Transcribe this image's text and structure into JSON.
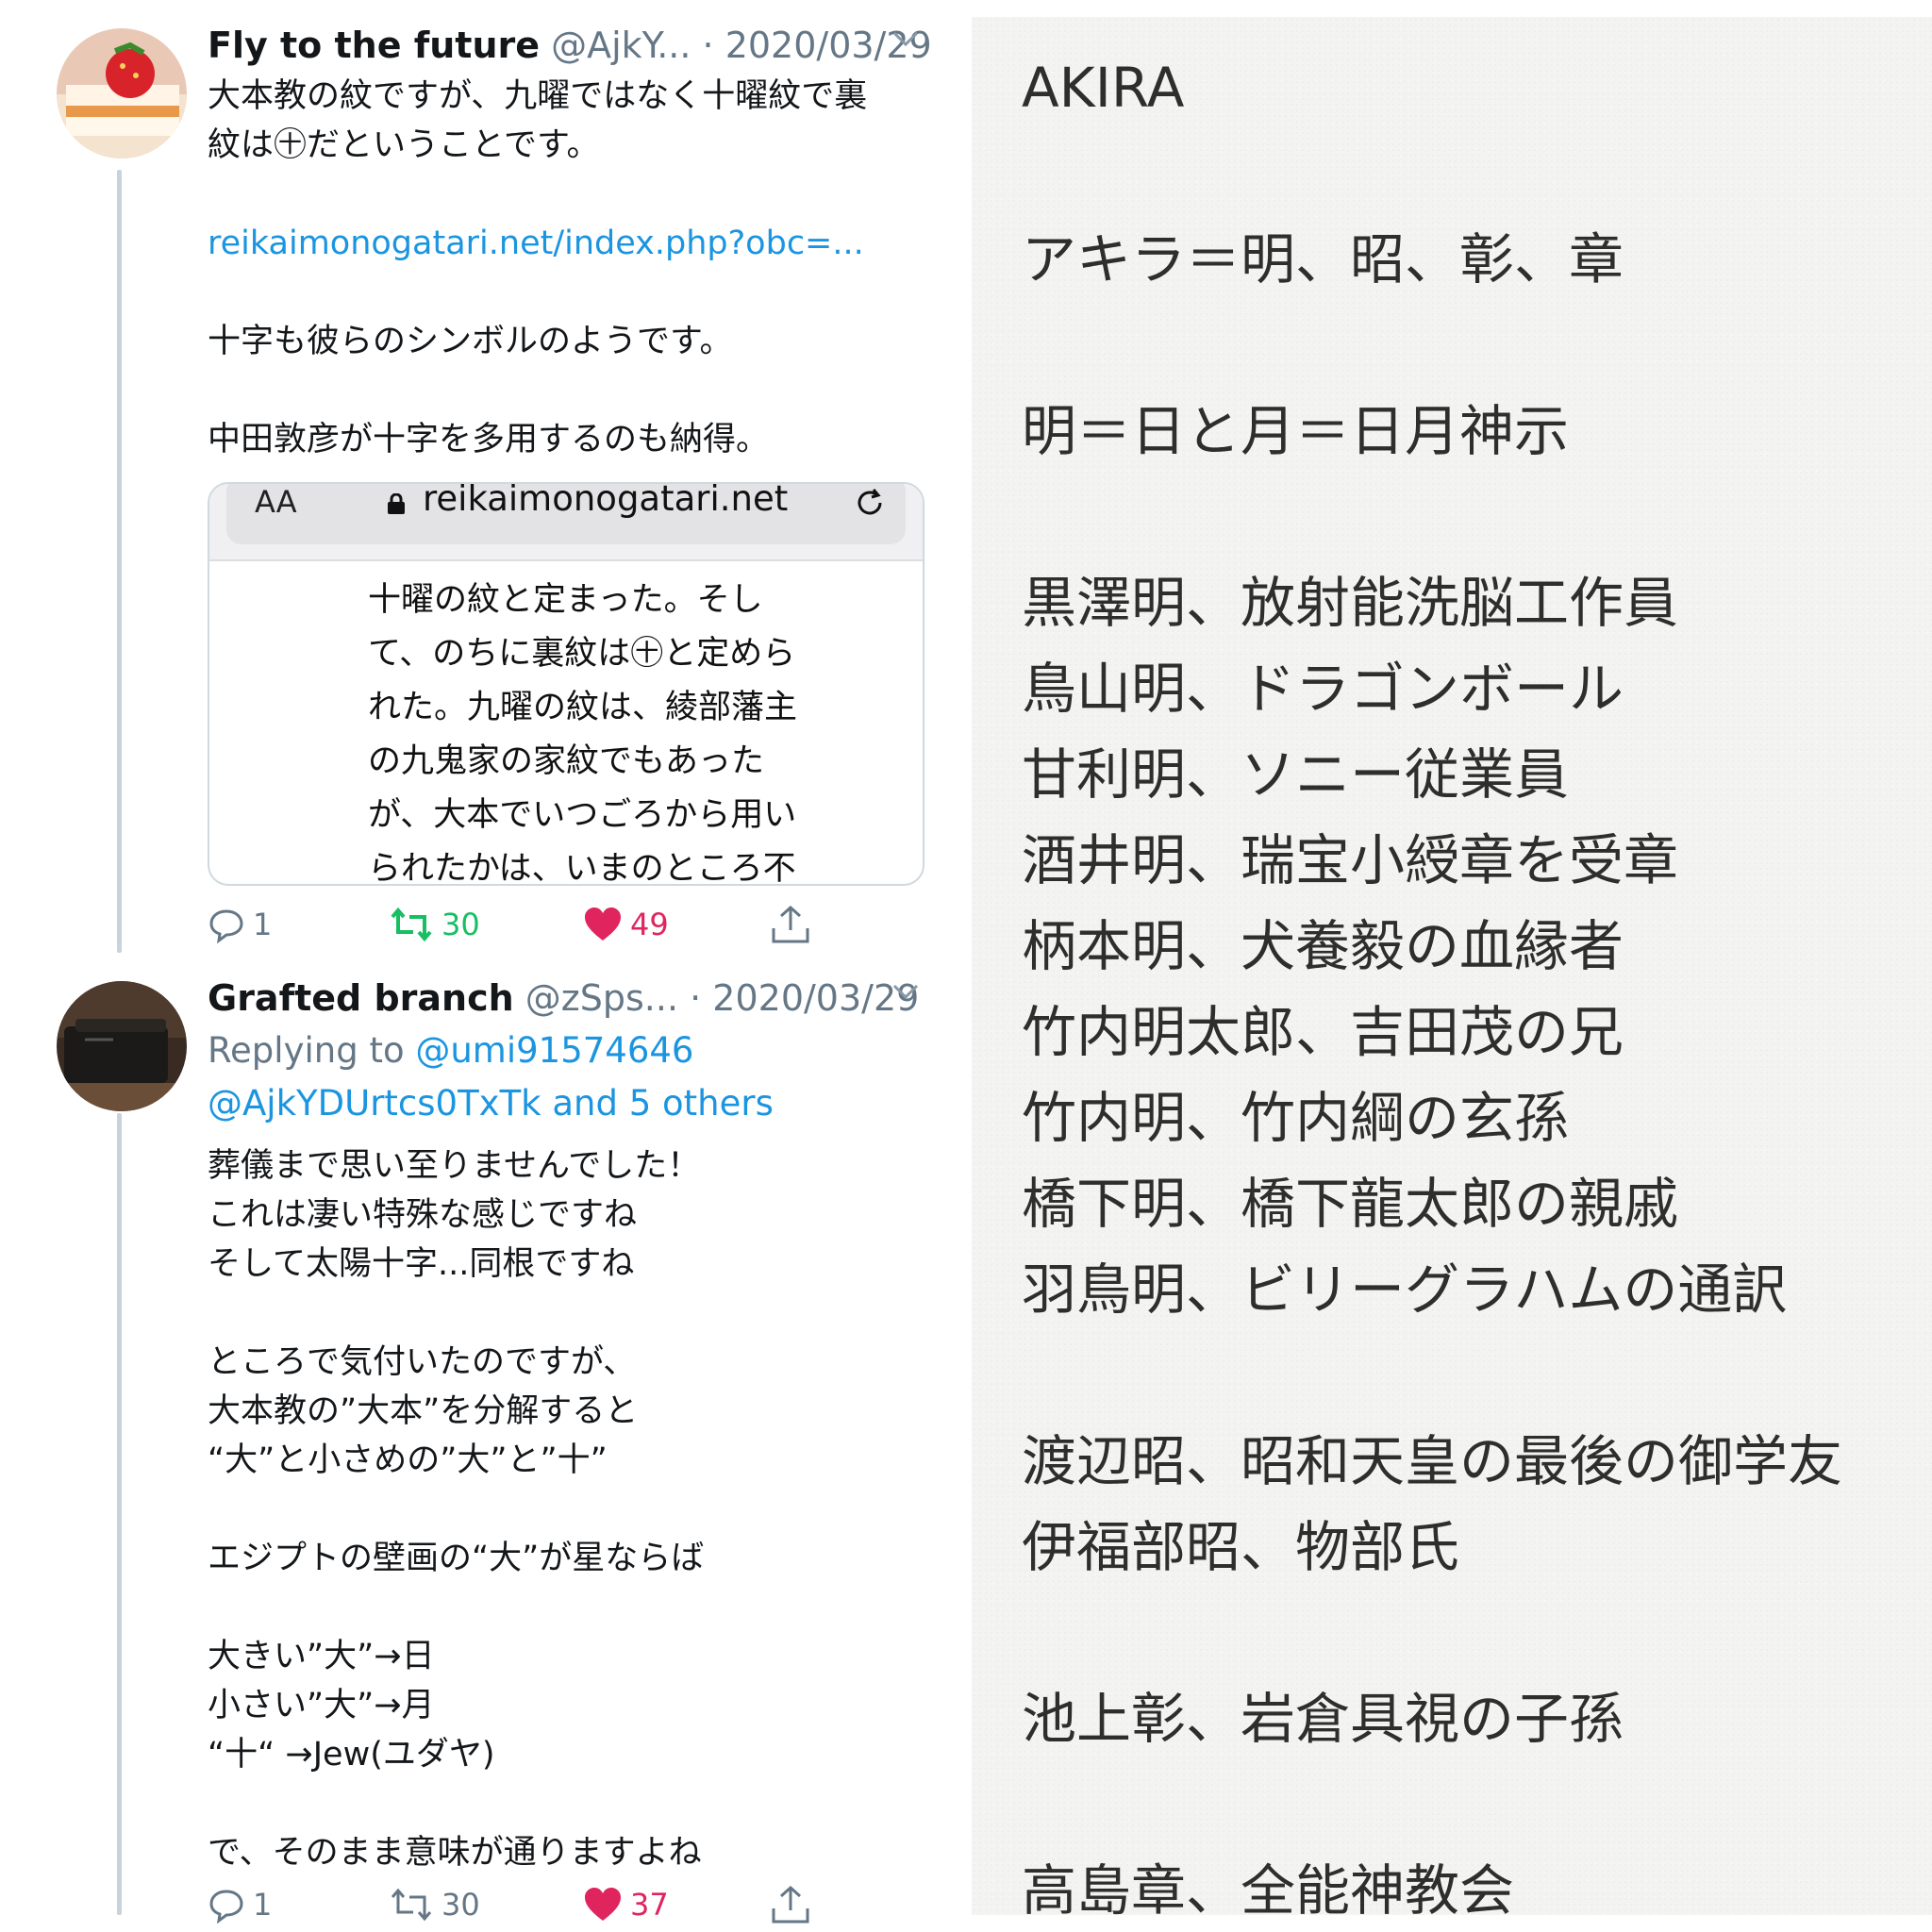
{
  "tweet1": {
    "name": "Fly to the future",
    "handle": "@AjkY...",
    "date": "· 2020/03/29",
    "lines": [
      "大本教の紋ですが、九曜ではなく十曜紋で裏",
      "紋は㊉だということです。",
      "",
      "reikaimonogatari.net/index.php?obc=...",
      "",
      "十字も彼らのシンボルのようです。",
      "",
      "中田敦彦が十字を多用するのも納得。"
    ],
    "card": {
      "aa_label": "AA",
      "domain": "reikaimonogatari.net",
      "body_lines": [
        "十曜の紋と定まった。そし",
        "て、のちに裏紋は㊉と定めら",
        "れた。九曜の紋は、綾部藩主",
        "の九鬼家の家紋でもあった",
        "が、大本でいつごろから用い",
        "られたかは、いまのところ不"
      ]
    },
    "replies": "1",
    "retweets": "30",
    "likes": "49"
  },
  "tweet2": {
    "name": "Grafted branch",
    "handle": "@zSps...",
    "date": "· 2020/03/29",
    "replying_prefix": "Replying to ",
    "replying_to": "@umi91574646",
    "replying_to_line2": "@AjkYDUrtcs0TxTk and 5 others",
    "lines": [
      "葬儀まで思い至りませんでした！",
      "これは凄い特殊な感じですね",
      "そして太陽十字...同根ですね",
      "",
      "ところで気付いたのですが、",
      "大本教の”大本”を分解すると",
      "“大”と小さめの”大”と”十”",
      "",
      "エジプトの壁画の“大”が星ならば",
      "",
      "大きい”大”→日",
      "小さい”大”→月",
      "“十“ →Jew(ユダヤ)",
      "",
      "で、そのまま意味が通りますよね"
    ],
    "replies": "1",
    "retweets": "30",
    "likes": "37"
  },
  "note": {
    "lines": [
      "AKIRA",
      "アキラ＝明、昭、彰、章",
      "明＝日と月＝日月神示",
      "黒澤明、放射能洗脳工作員",
      "鳥山明、ドラゴンボール",
      "甘利明、ソニー従業員",
      "酒井明、瑞宝小綬章を受章",
      "柄本明、犬養毅の血縁者",
      "竹内明太郎、吉田茂の兄",
      "竹内明、竹内綱の玄孫",
      "橋下明、橋下龍太郎の親戚",
      "羽鳥明、ビリーグラハムの通訳",
      "渡辺昭、昭和天皇の最後の御学友",
      "伊福部昭、物部氏",
      "池上彰、岩倉具視の子孫",
      "高島章、全能神教会"
    ]
  },
  "colors": {
    "link": "#1b95e0",
    "retweet": "#17bf63",
    "like": "#e0245e",
    "muted": "#657786"
  },
  "icons": [
    "reply-icon",
    "retweet-icon",
    "heart-icon",
    "share-icon",
    "chevron-down-icon",
    "lock-icon",
    "reload-icon"
  ]
}
